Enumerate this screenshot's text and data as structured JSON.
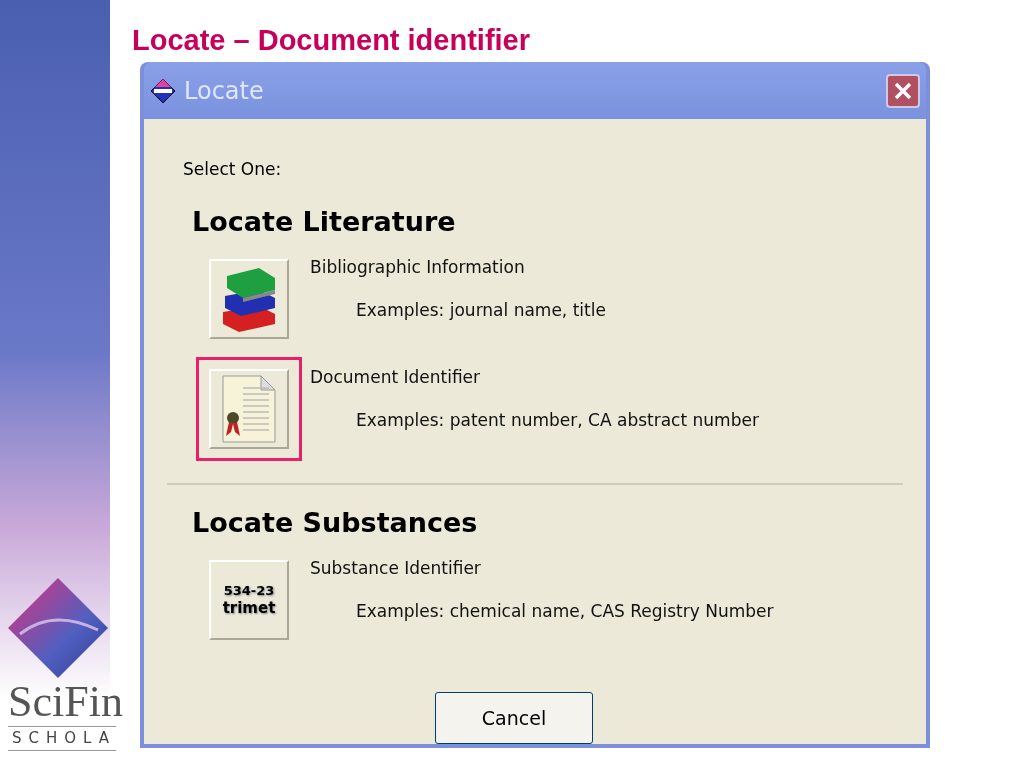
{
  "slide_title": "Locate – Document identifier",
  "logo": {
    "name": "SciFin",
    "subtitle": "SCHOLA"
  },
  "window": {
    "title": "Locate",
    "prompt": "Select One:",
    "sections": [
      {
        "heading": "Locate Literature",
        "options": [
          {
            "kind": "books",
            "label": "Bibliographic Information",
            "examples": "Examples: journal name, title",
            "highlighted": false
          },
          {
            "kind": "document",
            "label": "Document Identifier",
            "examples": "Examples: patent number, CA abstract number",
            "highlighted": true
          }
        ]
      },
      {
        "heading": "Locate Substances",
        "options": [
          {
            "kind": "substance",
            "icon_lines": [
              "534-23",
              "trimet"
            ],
            "label": "Substance Identifier",
            "examples": "Examples: chemical name, CAS Registry Number",
            "highlighted": false
          }
        ]
      }
    ],
    "buttons": [
      "Cancel"
    ]
  }
}
